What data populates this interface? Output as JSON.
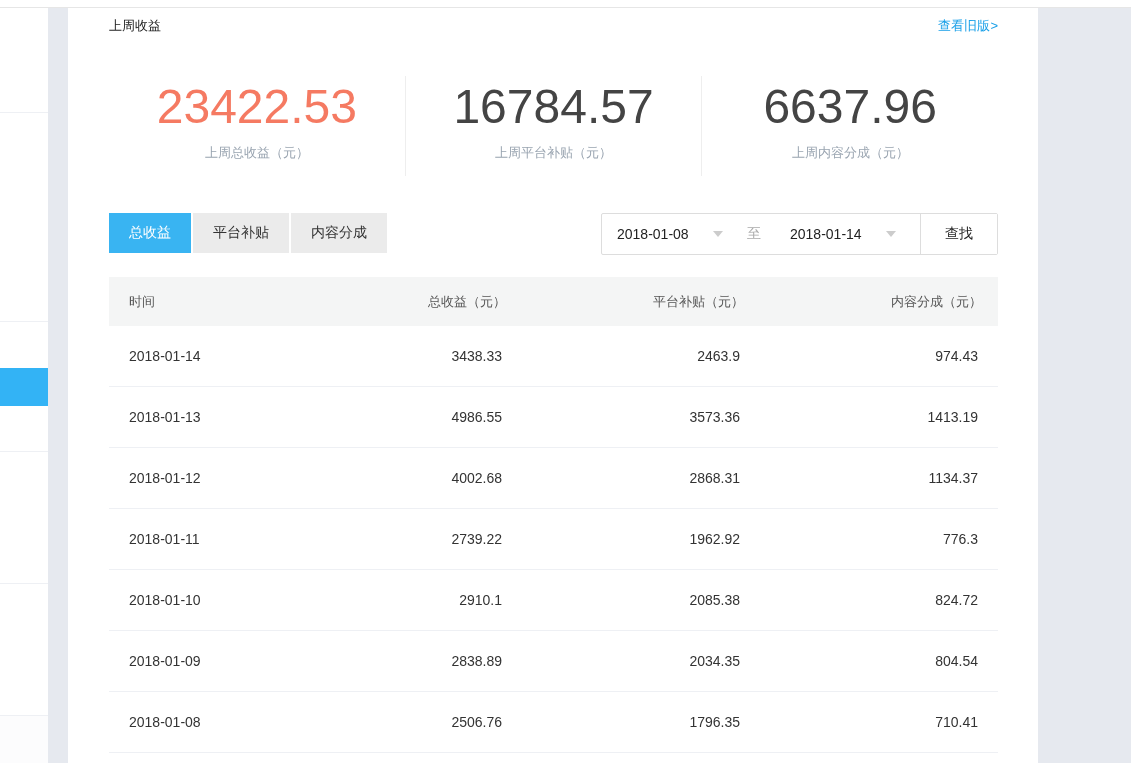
{
  "sidebar": {
    "items": [
      {
        "selected": true
      }
    ]
  },
  "header": {
    "title": "上周收益",
    "link": "查看旧版>"
  },
  "stats": [
    {
      "value": "23422.53",
      "label": "上周总收益（元）",
      "highlight": true
    },
    {
      "value": "16784.57",
      "label": "上周平台补贴（元）",
      "highlight": false
    },
    {
      "value": "6637.96",
      "label": "上周内容分成（元）",
      "highlight": false
    }
  ],
  "tabs": [
    {
      "label": "总收益",
      "selected": true
    },
    {
      "label": "平台补贴",
      "selected": false
    },
    {
      "label": "内容分成",
      "selected": false
    }
  ],
  "date_range": {
    "start": "2018-01-08",
    "separator": "至",
    "end": "2018-01-14",
    "button": "查找"
  },
  "table": {
    "columns": [
      "时间",
      "总收益（元）",
      "平台补贴（元）",
      "内容分成（元）"
    ],
    "rows": [
      [
        "2018-01-14",
        "3438.33",
        "2463.9",
        "974.43"
      ],
      [
        "2018-01-13",
        "4986.55",
        "3573.36",
        "1413.19"
      ],
      [
        "2018-01-12",
        "4002.68",
        "2868.31",
        "1134.37"
      ],
      [
        "2018-01-11",
        "2739.22",
        "1962.92",
        "776.3"
      ],
      [
        "2018-01-10",
        "2910.1",
        "2085.38",
        "824.72"
      ],
      [
        "2018-01-09",
        "2838.89",
        "2034.35",
        "804.54"
      ],
      [
        "2018-01-08",
        "2506.76",
        "1796.35",
        "710.41"
      ]
    ]
  }
}
